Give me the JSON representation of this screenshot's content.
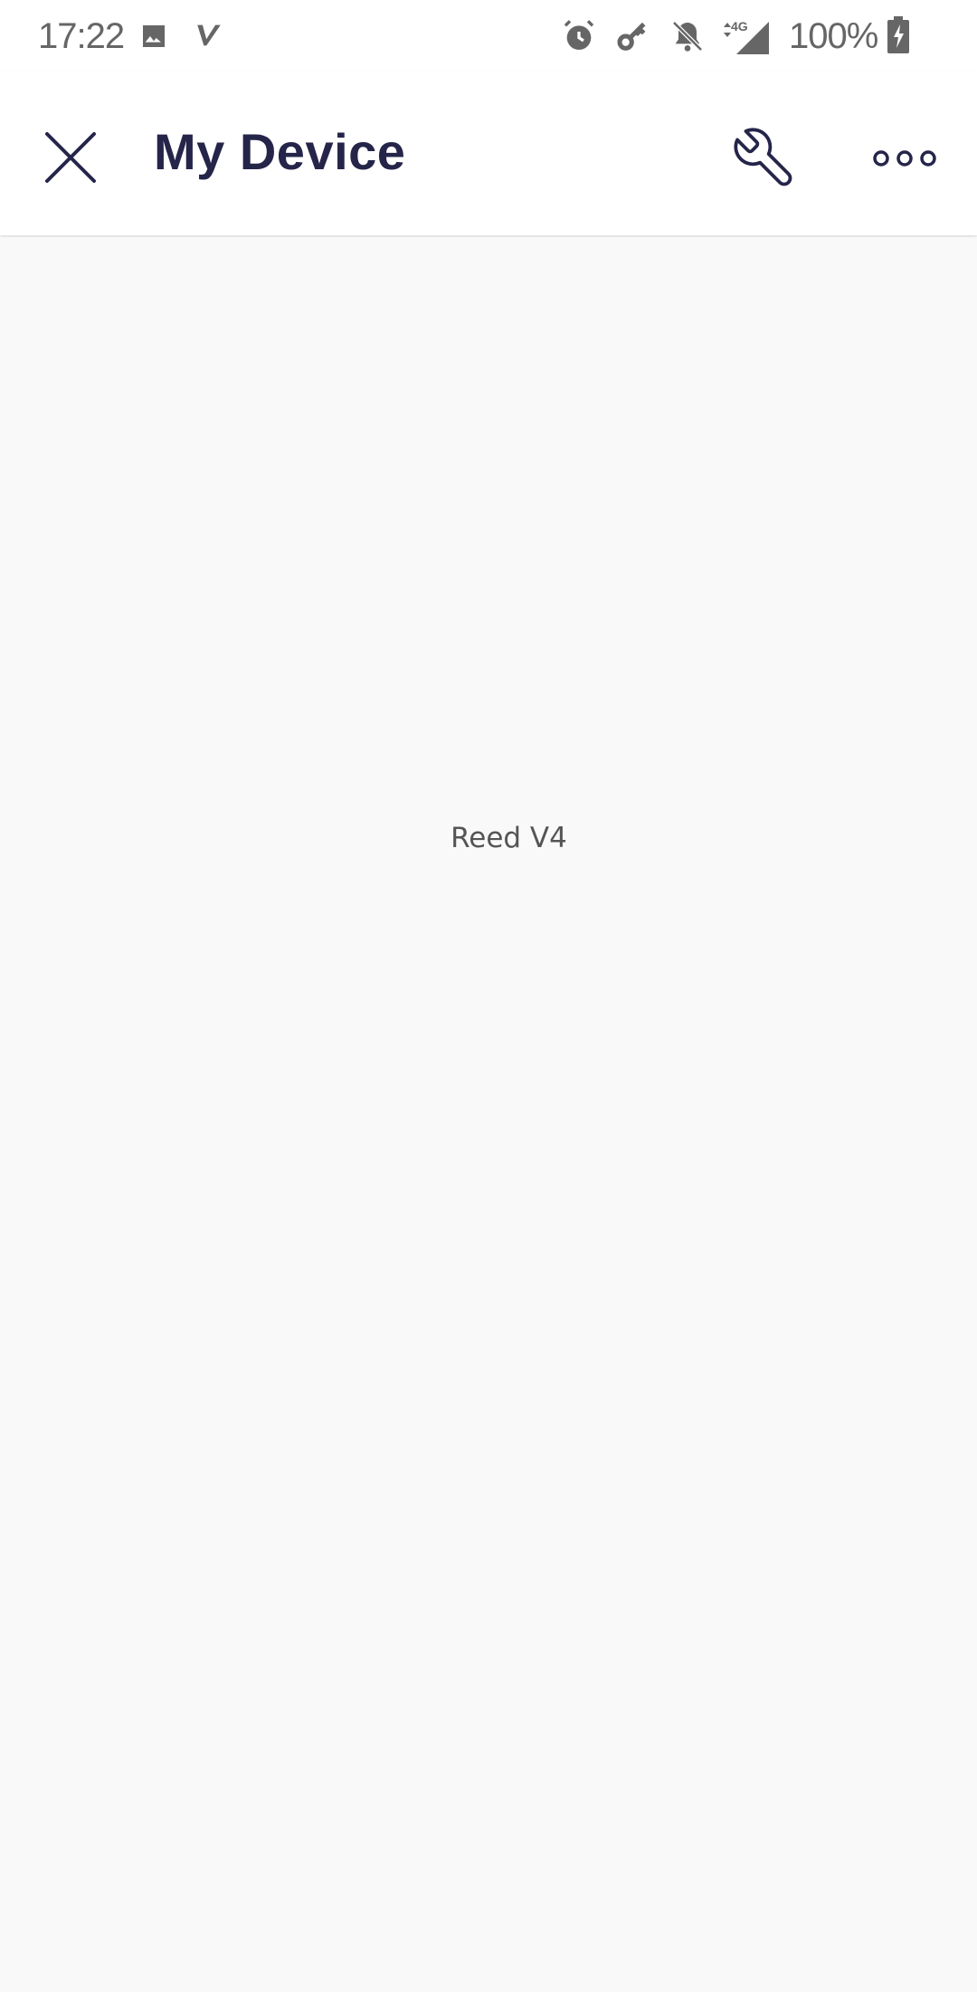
{
  "status_bar": {
    "time": "17:22",
    "battery_percent": "100%",
    "network_label": "4G",
    "icons": [
      "image-icon",
      "app-v-icon",
      "alarm-icon",
      "key-icon",
      "bell-off-icon",
      "signal-4g-icon",
      "battery-charging-icon"
    ]
  },
  "app_bar": {
    "title": "My Device",
    "close_icon": "close-icon",
    "settings_icon": "wrench-icon",
    "more_icon": "more-horizontal-icon"
  },
  "content": {
    "device_name": "Reed V4"
  },
  "colors": {
    "title": "#25254a",
    "icon": "#25254a",
    "background": "#f9f9f9",
    "status_text": "#666666"
  }
}
